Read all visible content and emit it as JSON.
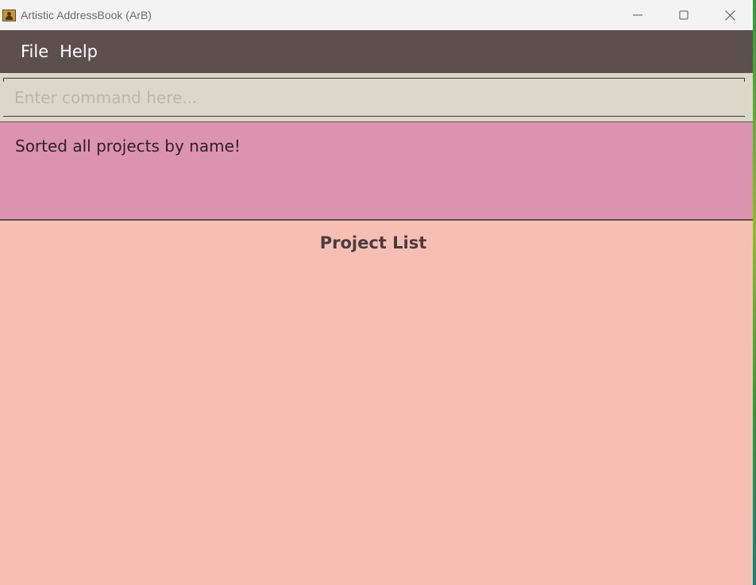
{
  "window": {
    "title": "Artistic AddressBook (ArB)",
    "controls": {
      "minimize_icon": "minimize-icon",
      "maximize_icon": "maximize-icon",
      "close_icon": "close-icon"
    }
  },
  "menubar": {
    "items": [
      {
        "label": "File"
      },
      {
        "label": "Help"
      }
    ]
  },
  "command": {
    "placeholder": "Enter command here...",
    "value": ""
  },
  "result": {
    "message": "Sorted all projects by name!"
  },
  "project_panel": {
    "title": "Project List",
    "items": []
  },
  "colors": {
    "menubar_bg": "#5c4f4c",
    "command_bg": "#dbd8ca",
    "result_bg": "#dc93af",
    "list_bg": "#f7bfb3"
  }
}
